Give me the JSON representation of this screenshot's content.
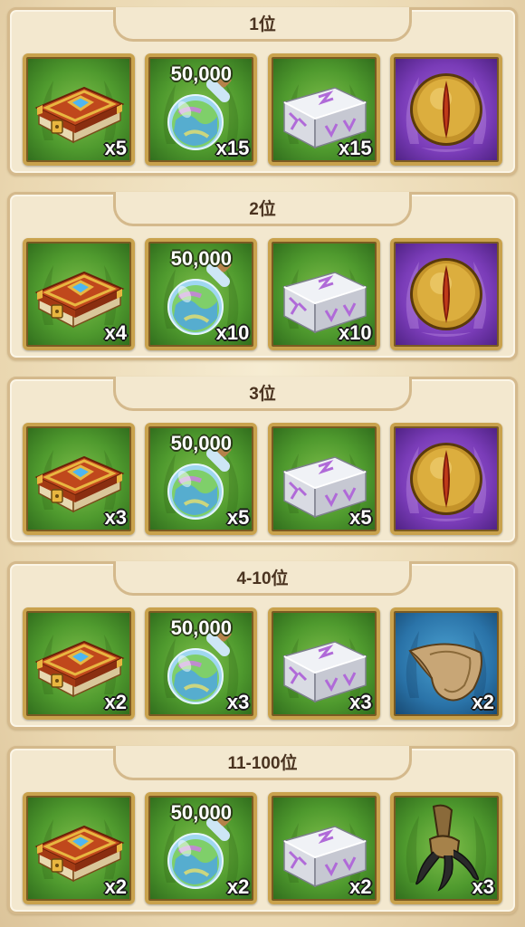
{
  "tiers": [
    {
      "rank": "1位",
      "items": [
        {
          "icon": "book-icon",
          "qty": "x5"
        },
        {
          "icon": "potion-icon",
          "amount": "50,000",
          "qty": "x15"
        },
        {
          "icon": "chest-icon",
          "qty": "x15"
        },
        {
          "icon": "eye-icon",
          "qty": ""
        }
      ]
    },
    {
      "rank": "2位",
      "items": [
        {
          "icon": "book-icon",
          "qty": "x4"
        },
        {
          "icon": "potion-icon",
          "amount": "50,000",
          "qty": "x10"
        },
        {
          "icon": "chest-icon",
          "qty": "x10"
        },
        {
          "icon": "eye-icon",
          "qty": ""
        }
      ]
    },
    {
      "rank": "3位",
      "items": [
        {
          "icon": "book-icon",
          "qty": "x3"
        },
        {
          "icon": "potion-icon",
          "amount": "50,000",
          "qty": "x5"
        },
        {
          "icon": "chest-icon",
          "qty": "x5"
        },
        {
          "icon": "eye-icon",
          "qty": ""
        }
      ]
    },
    {
      "rank": "4-10位",
      "items": [
        {
          "icon": "book-icon",
          "qty": "x2"
        },
        {
          "icon": "potion-icon",
          "amount": "50,000",
          "qty": "x3"
        },
        {
          "icon": "chest-icon",
          "qty": "x3"
        },
        {
          "icon": "hood-icon",
          "qty": "x2"
        }
      ]
    },
    {
      "rank": "11-100位",
      "items": [
        {
          "icon": "book-icon",
          "qty": "x2"
        },
        {
          "icon": "potion-icon",
          "amount": "50,000",
          "qty": "x2"
        },
        {
          "icon": "chest-icon",
          "qty": "x2"
        },
        {
          "icon": "claw-icon",
          "qty": "x3"
        }
      ]
    }
  ]
}
